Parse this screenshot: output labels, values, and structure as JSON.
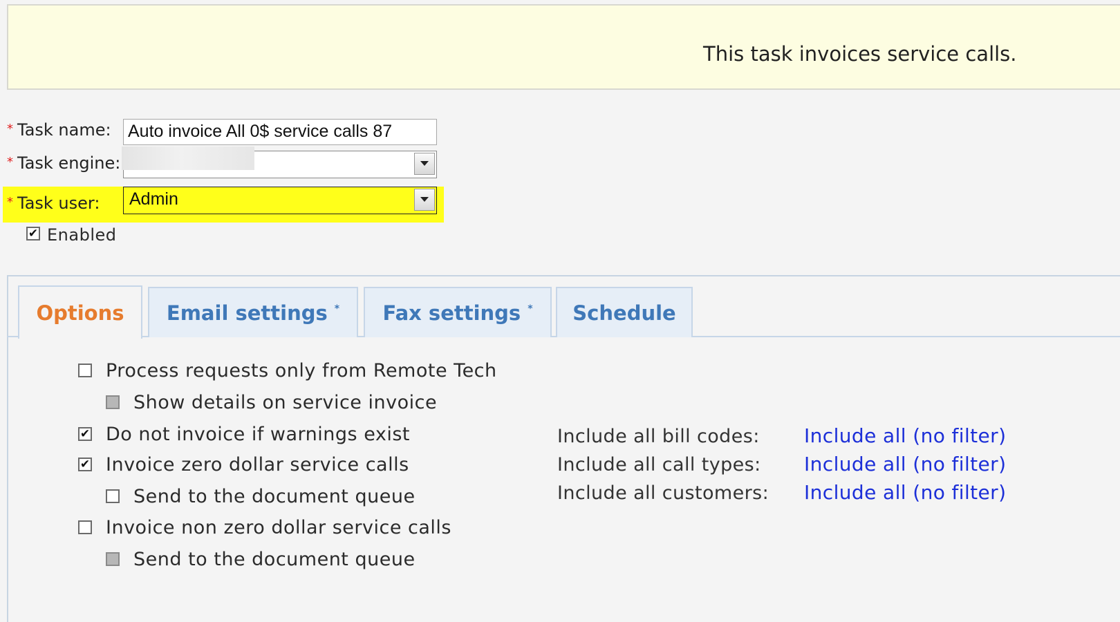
{
  "banner": {
    "text": "This task invoices service calls."
  },
  "form": {
    "task_name_label": "Task name:",
    "task_name_value": "Auto invoice All 0$ service calls 87",
    "task_engine_label": "Task engine:",
    "task_user_label": "Task user:",
    "task_user_value": "Admin",
    "enabled_label": "Enabled",
    "enabled_checked": true,
    "required_marker": "*",
    "highlight_color": "#ffff1a"
  },
  "tabs": [
    {
      "label": "Options",
      "marker": "",
      "active": true
    },
    {
      "label": "Email settings",
      "marker": "*",
      "active": false
    },
    {
      "label": "Fax settings",
      "marker": "*",
      "active": false
    },
    {
      "label": "Schedule",
      "marker": "",
      "active": false
    }
  ],
  "options": {
    "process_remote_tech": {
      "label": "Process requests only from Remote Tech",
      "checked": false
    },
    "show_details": {
      "label": "Show details on service invoice",
      "checked": false,
      "disabled": true
    },
    "no_invoice_warnings": {
      "label": "Do not invoice if warnings exist",
      "checked": true
    },
    "invoice_zero_dollar": {
      "label": "Invoice zero dollar service calls",
      "checked": true
    },
    "zero_send_queue": {
      "label": "Send to the document queue",
      "checked": false
    },
    "invoice_non_zero": {
      "label": "Invoice non zero dollar service calls",
      "checked": false
    },
    "non_zero_send_queue": {
      "label": "Send to the document queue",
      "checked": false,
      "disabled": true
    }
  },
  "filters": [
    {
      "label": "Include all bill codes:",
      "link": "Include all (no filter)"
    },
    {
      "label": "Include all call types:",
      "link": "Include all (no filter)"
    },
    {
      "label": "Include all customers:",
      "link": "Include all (no filter)"
    }
  ],
  "colors": {
    "active_tab": "#e67c2e",
    "inactive_tab": "#3f78b8",
    "link": "#1c2fd8",
    "banner_bg": "#fdfde1"
  }
}
